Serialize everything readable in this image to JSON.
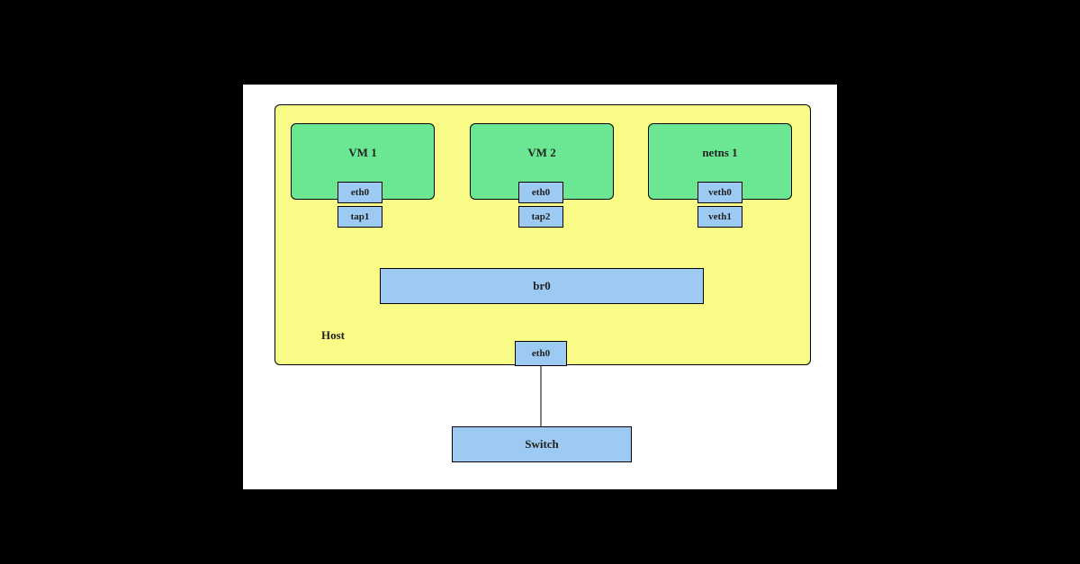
{
  "host": {
    "label": "Host"
  },
  "vm1": {
    "title": "VM 1",
    "iface_upper": "eth0",
    "iface_lower": "tap1"
  },
  "vm2": {
    "title": "VM 2",
    "iface_upper": "eth0",
    "iface_lower": "tap2"
  },
  "netns1": {
    "title": "netns 1",
    "iface_upper": "veth0",
    "iface_lower": "veth1"
  },
  "bridge": {
    "label": "br0"
  },
  "host_iface": {
    "label": "eth0"
  },
  "switch": {
    "label": "Switch"
  },
  "colors": {
    "background": "#000000",
    "page": "#ffffff",
    "host_fill": "#f8fc87",
    "green_fill": "#6be793",
    "blue_fill": "#9ccaf2",
    "stroke": "#000000"
  }
}
